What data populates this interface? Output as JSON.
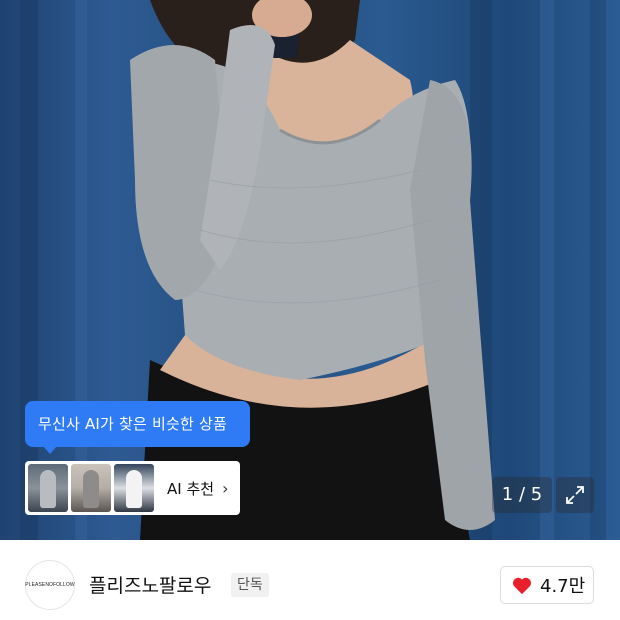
{
  "hero": {
    "ai_tooltip": "무신사 AI가 찾은 비슷한 상품",
    "ai_card_label": "AI 추천",
    "ai_card_chevron": "›",
    "thumbnails": [
      "thumbnail-1",
      "thumbnail-2",
      "thumbnail-3"
    ],
    "pager": {
      "current": 1,
      "total": 5,
      "text": "1 / 5"
    },
    "expand_icon": "expand-icon"
  },
  "brand": {
    "logo_text": "PLEASENOFOLLOW",
    "name": "플리즈노팔로우",
    "tag": "단독",
    "likes": "4.7만",
    "heart_color": "#e8202b"
  },
  "colors": {
    "accent": "#2f7bf5",
    "background": "#ffffff"
  }
}
